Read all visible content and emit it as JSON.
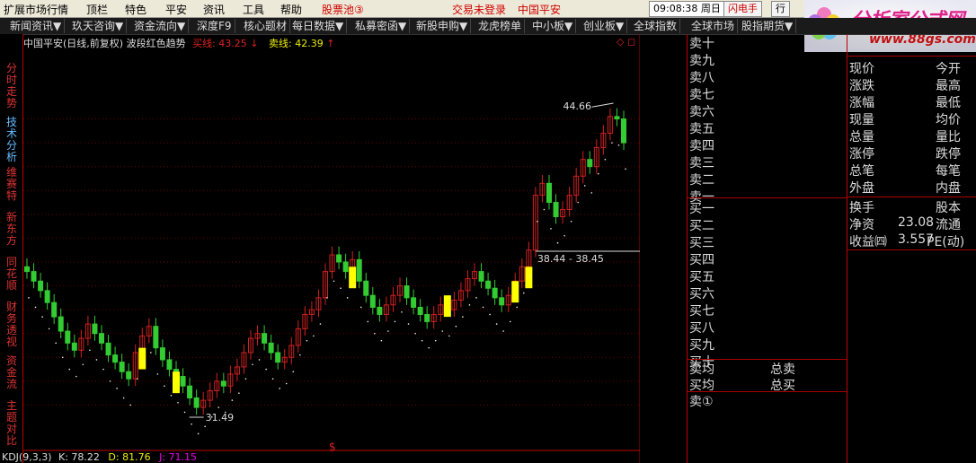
{
  "menubar": {
    "items": [
      "扩展市场行情",
      "顶栏",
      "特色",
      "平安",
      "资讯",
      "工具",
      "帮助"
    ],
    "stock_pool": "股票池③",
    "trade_status": "交易未登录",
    "stock_name": "中国平安",
    "time": "09:08:38 周日",
    "flash_button": "闪电手",
    "row_button": "行"
  },
  "logo": {
    "title": "分析家公式网",
    "url": "www.88gs.com"
  },
  "tabs": [
    "新闻资讯▼",
    "玖天咨询▼",
    "资金流向▼",
    "深度F9",
    "核心题材",
    "每日数据▼",
    "私募密函▼",
    "新股申购▼",
    "龙虎榜单",
    "中小板▼",
    "创业板▼",
    "全球指数",
    "全球市场",
    "股指期货▼"
  ],
  "left_tabs": [
    "分时走势",
    "技术分析",
    "维赛特",
    "新东方",
    "同花顺",
    "财务透视",
    "资金流",
    "主题对比"
  ],
  "chart_header": {
    "title": "中国平安(日线,前复权) 波段红色趋势",
    "buy_label": "买线: 43.25",
    "sell_label": "卖线: 42.39"
  },
  "indicator": {
    "name": "KDJ(9,3,3)",
    "k": "K: 78.22",
    "d": "D: 81.76",
    "j": "J: 71.15"
  },
  "annotations": {
    "high": "44.66",
    "low": "31.49",
    "range": "38.44 - 38.45",
    "dollar": "$"
  },
  "chart_data": {
    "type": "candlestick",
    "y_ticks": [
      "44.00",
      "43.00",
      "42.00",
      "41.00",
      "40.00",
      "39.00",
      "38.00",
      "37.00",
      "36.00",
      "35.00",
      "34.00",
      "33.00",
      "32.00"
    ],
    "ylim": [
      31.0,
      45.3
    ],
    "max": 44.66,
    "min": 31.49,
    "closes": [
      37.6,
      37.2,
      36.8,
      36.3,
      35.7,
      35.1,
      34.6,
      34.3,
      34.8,
      35.4,
      35.0,
      34.6,
      34.1,
      33.8,
      33.4,
      33.1,
      34.2,
      34.9,
      35.3,
      34.4,
      33.9,
      33.5,
      33.2,
      32.8,
      32.3,
      31.9,
      32.2,
      32.6,
      33.0,
      32.8,
      33.3,
      33.6,
      34.2,
      34.8,
      35.0,
      34.6,
      34.2,
      33.8,
      34.0,
      34.5,
      35.2,
      35.8,
      36.0,
      36.5,
      37.6,
      38.3,
      38.0,
      37.6,
      38.1,
      37.2,
      36.6,
      36.1,
      35.8,
      36.2,
      36.6,
      37.0,
      36.5,
      36.1,
      35.8,
      35.5,
      35.8,
      36.2,
      36.0,
      36.4,
      36.8,
      37.3,
      37.6,
      37.2,
      36.9,
      36.5,
      36.2,
      36.6,
      37.2,
      37.8,
      38.5,
      40.8,
      41.3,
      40.5,
      39.9,
      40.2,
      40.8,
      41.6,
      42.3,
      42.0,
      42.8,
      43.4,
      44.1,
      44.0,
      43.0
    ],
    "up_color": "#d02020",
    "down_color": "#33cc33",
    "signal_color": "#ffff00"
  },
  "book": {
    "sells": [
      "卖十",
      "卖九",
      "卖八",
      "卖七",
      "卖六",
      "卖五",
      "卖四",
      "卖三",
      "卖二",
      "卖一"
    ],
    "buys": [
      "买一",
      "买二",
      "买三",
      "买四",
      "买五",
      "买六",
      "买七",
      "买八",
      "买九",
      "买十"
    ],
    "sell_avg": "卖均",
    "buy_avg": "买均",
    "total_sell": "总卖",
    "total_buy": "总买",
    "sell_one": "卖①"
  },
  "quote": {
    "left": [
      "现价",
      "涨跌",
      "涨幅",
      "现量",
      "总量",
      "涨停",
      "总笔",
      "外盘"
    ],
    "right": [
      "今开",
      "最高",
      "最低",
      "均价",
      "量比",
      "跌停",
      "每笔",
      "内盘"
    ],
    "turnover": "换手",
    "equity": "股本",
    "nav_label": "净资",
    "nav_value": "23.08",
    "float": "流通",
    "eps_label": "收益㈣",
    "eps_value": "3.557",
    "pe": "PE(动)"
  },
  "colors": {
    "accent_red": "#b00000",
    "grid_red": "#8b0000",
    "text": "#dddddd"
  }
}
